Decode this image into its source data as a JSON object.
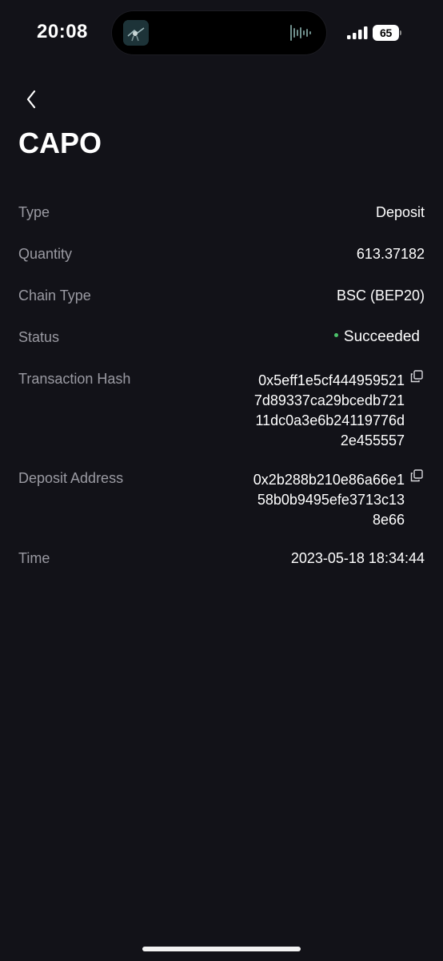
{
  "status_bar": {
    "time": "20:08",
    "battery": "65",
    "icons": [
      "now-playing-artwork",
      "audio-waveform-icon",
      "cellular-signal-icon",
      "battery-icon"
    ]
  },
  "nav": {
    "back_icon": "chevron-left-icon"
  },
  "page": {
    "title": "CAPO"
  },
  "details": {
    "type": {
      "label": "Type",
      "value": "Deposit"
    },
    "quantity": {
      "label": "Quantity",
      "value": "613.37182"
    },
    "chain_type": {
      "label": "Chain Type",
      "value": "BSC (BEP20)"
    },
    "status": {
      "label": "Status",
      "value": "Succeeded",
      "color": "#4cc26a"
    },
    "transaction_hash": {
      "label": "Transaction Hash",
      "lines": [
        "0x5eff1e5cf444959521",
        "7d89337ca29bcedb721",
        "11dc0a3e6b24119776d",
        "2e455557"
      ],
      "copy_icon": "copy-icon"
    },
    "deposit_address": {
      "label": "Deposit Address",
      "lines": [
        "0x2b288b210e86a66e1",
        "58b0b9495efe3713c13",
        "8e66"
      ],
      "copy_icon": "copy-icon"
    },
    "time": {
      "label": "Time",
      "value": "2023-05-18 18:34:44"
    }
  },
  "colors": {
    "background": "#121218",
    "label": "#9a9aa2",
    "value": "#ffffff",
    "success": "#4cc26a"
  }
}
